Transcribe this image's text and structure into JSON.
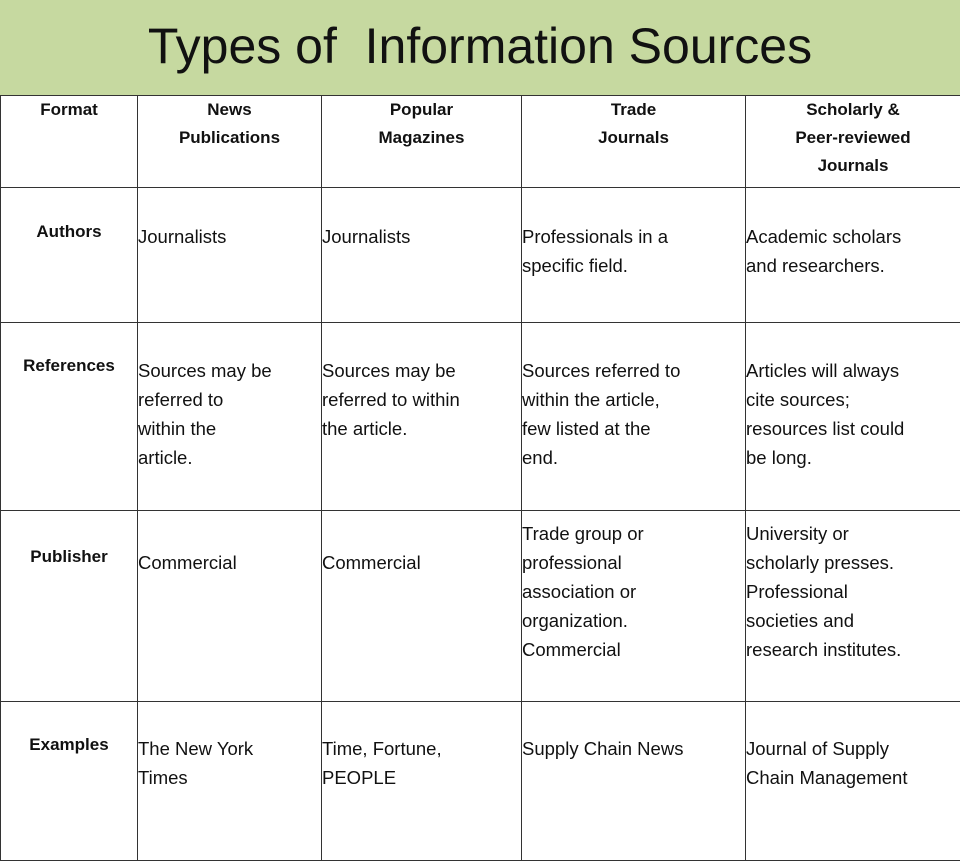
{
  "title": "Types of  Information Sources",
  "headers": [
    [
      "Format"
    ],
    [
      "News",
      "Publications"
    ],
    [
      "Popular",
      "Magazines"
    ],
    [
      "Trade",
      "Journals"
    ],
    [
      "Scholarly &",
      "Peer-reviewed",
      "Journals"
    ]
  ],
  "rows": [
    {
      "label": "Authors",
      "cells": [
        [
          "Journalists"
        ],
        [
          "Journalists"
        ],
        [
          "Professionals in a",
          "specific field."
        ],
        [
          "Academic scholars",
          "and researchers."
        ]
      ]
    },
    {
      "label": "References",
      "cells": [
        [
          "Sources may be",
          "referred to",
          "within the",
          "article."
        ],
        [
          "Sources may be",
          "referred to within",
          "the article."
        ],
        [
          "Sources referred to",
          "within the article,",
          "few listed at the",
          "end."
        ],
        [
          "Articles will always",
          "cite sources;",
          "resources list could",
          "be long."
        ]
      ]
    },
    {
      "label": "Publisher",
      "cells": [
        [
          "Commercial"
        ],
        [
          "Commercial"
        ],
        [
          "Trade group or",
          "professional",
          "association or",
          "organization.",
          "Commercial"
        ],
        [
          "University or",
          "scholarly presses.",
          "Professional",
          "societies and",
          "research institutes."
        ]
      ]
    },
    {
      "label": "Examples",
      "cells": [
        [
          "The New York",
          "Times"
        ],
        [
          "Time, Fortune,",
          "PEOPLE"
        ],
        [
          "Supply Chain News"
        ],
        [
          "Journal of Supply",
          "Chain Management"
        ]
      ]
    }
  ]
}
